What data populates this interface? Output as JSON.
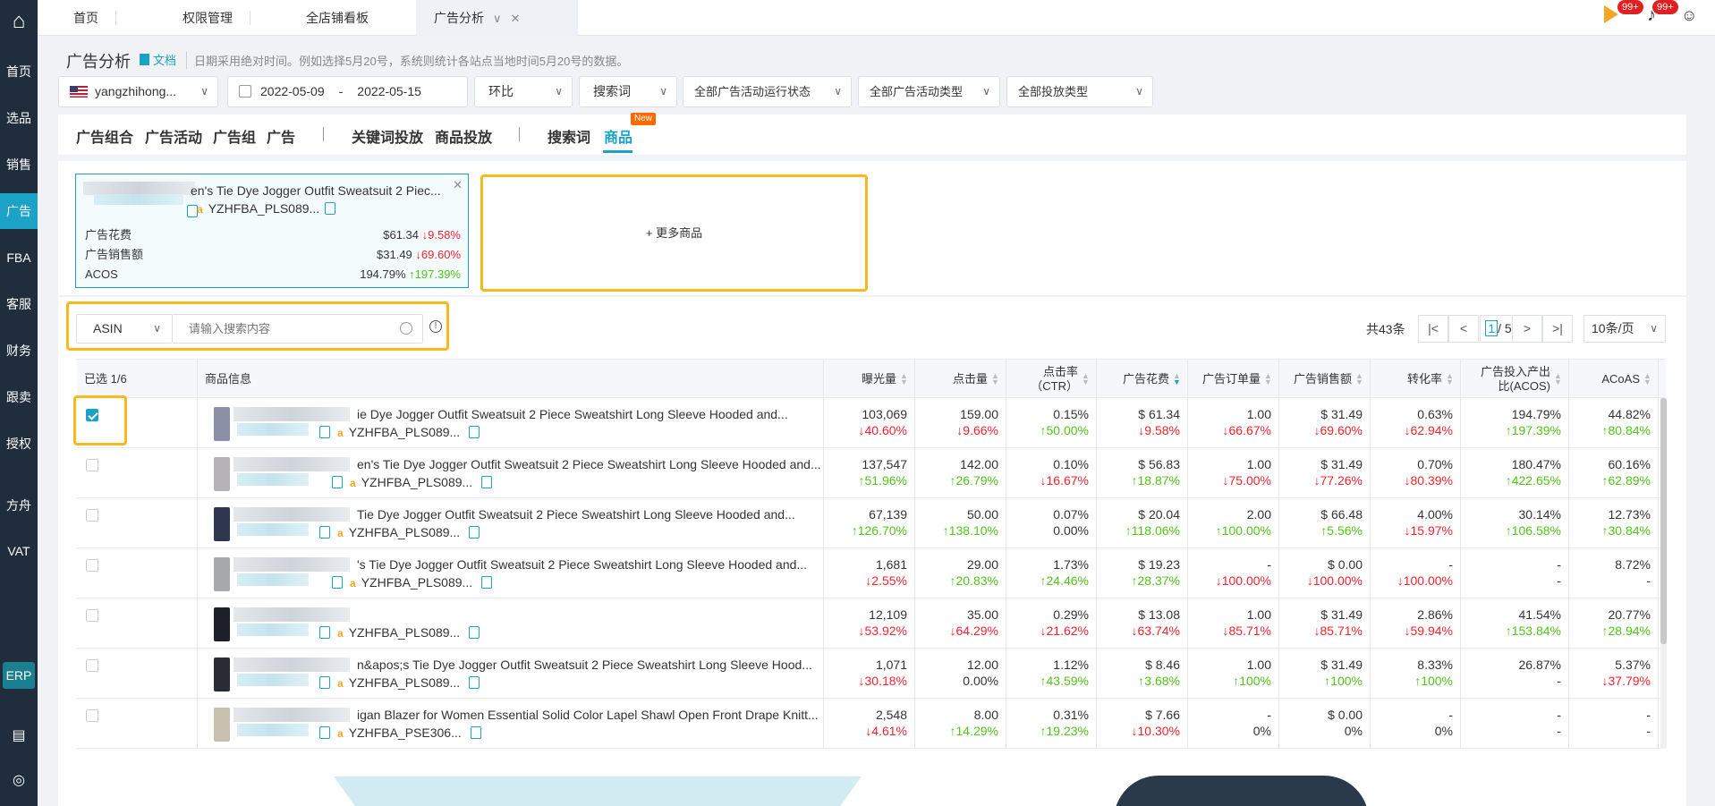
{
  "sidebar": {
    "items": [
      "首页",
      "选品",
      "销售",
      "广告",
      "FBA",
      "客服",
      "财务",
      "跟卖",
      "授权",
      "方舟",
      "VAT"
    ],
    "active_index": 3,
    "erp_label": "ERP"
  },
  "top_tabs": [
    "首页",
    "权限管理",
    "全店铺看板",
    "广告分析"
  ],
  "notifications": {
    "badge_a": "99+",
    "badge_b": "99+"
  },
  "header": {
    "title": "广告分析",
    "doc_label": "文档",
    "note": "日期采用绝对时间。例如选择5月20号，系统则统计各站点当地时间5月20号的数据。"
  },
  "filters": {
    "store": "yangzhihong...",
    "date_start": "2022-05-09",
    "date_sep": "-",
    "date_end": "2022-05-15",
    "compare": "环比",
    "dimension": "搜索词",
    "status": "全部广告活动运行状态",
    "campaign_type": "全部广告活动类型",
    "placement": "全部投放类型"
  },
  "type_tabs": [
    "广告组合",
    "广告活动",
    "广告组",
    "广告",
    "关键词投放",
    "商品投放",
    "搜索词",
    "商品"
  ],
  "new_badge": "New",
  "compare_card": {
    "title": "en's Tie Dye Jogger Outfit Sweatsuit 2 Piec...",
    "asin": "YZHFBA_PLS089...",
    "metrics": [
      {
        "label": "广告花费",
        "value": "$61.34",
        "change": "↓9.58%",
        "dir": "down"
      },
      {
        "label": "广告销售额",
        "value": "$31.49",
        "change": "↓69.60%",
        "dir": "down"
      },
      {
        "label": "ACOS",
        "value": "194.79%",
        "change": "↑197.39%",
        "dir": "up"
      }
    ],
    "add_more": "+ 更多商品"
  },
  "search": {
    "field": "ASIN",
    "placeholder": "请输入搜索内容"
  },
  "pagination": {
    "total": "共43条",
    "current": "1",
    "pages": "/ 5",
    "page_size": "10条/页"
  },
  "table": {
    "columns": [
      "已选 1/6",
      "商品信息",
      "曝光量",
      "点击量",
      "点击率（CTR）",
      "广告花费",
      "广告订单量",
      "广告销售额",
      "转化率",
      "广告投入产出比(ACOS)",
      "ACoAS"
    ],
    "rows": [
      {
        "checked": true,
        "title": "ie Dye Jogger Outfit Sweatsuit 2 Piece Sweatshirt Long Sleeve Hooded and...",
        "asin": "YZHFBA_PLS089...",
        "cells": [
          [
            "103,069",
            "↓40.60%",
            "down"
          ],
          [
            "159.00",
            "↓9.66%",
            "down"
          ],
          [
            "0.15%",
            "↑50.00%",
            "up"
          ],
          [
            "$ 61.34",
            "↓9.58%",
            "down"
          ],
          [
            "1.00",
            "↓66.67%",
            "down"
          ],
          [
            "$ 31.49",
            "↓69.60%",
            "down"
          ],
          [
            "0.63%",
            "↓62.94%",
            "down"
          ],
          [
            "194.79%",
            "↑197.39%",
            "up"
          ],
          [
            "44.82%",
            "↑80.84%",
            "up"
          ]
        ]
      },
      {
        "checked": false,
        "title": "en's Tie Dye Jogger Outfit Sweatsuit 2 Piece Sweatshirt Long Sleeve Hooded and...",
        "asin": "YZHFBA_PLS089...",
        "cells": [
          [
            "137,547",
            "↑51.96%",
            "up"
          ],
          [
            "142.00",
            "↑26.79%",
            "up"
          ],
          [
            "0.10%",
            "↓16.67%",
            "down"
          ],
          [
            "$ 56.83",
            "↑18.87%",
            "up"
          ],
          [
            "1.00",
            "↓75.00%",
            "down"
          ],
          [
            "$ 31.49",
            "↓77.26%",
            "down"
          ],
          [
            "0.70%",
            "↓80.39%",
            "down"
          ],
          [
            "180.47%",
            "↑422.65%",
            "up"
          ],
          [
            "60.16%",
            "↑62.89%",
            "up"
          ]
        ]
      },
      {
        "checked": false,
        "title": "Tie Dye Jogger Outfit Sweatsuit 2 Piece Sweatshirt Long Sleeve Hooded and...",
        "asin": "YZHFBA_PLS089...",
        "cells": [
          [
            "67,139",
            "↑126.70%",
            "up"
          ],
          [
            "50.00",
            "↑138.10%",
            "up"
          ],
          [
            "0.07%",
            "0.00%",
            "neutral"
          ],
          [
            "$ 20.04",
            "↑118.06%",
            "up"
          ],
          [
            "2.00",
            "↑100.00%",
            "up"
          ],
          [
            "$ 66.48",
            "↑5.56%",
            "up"
          ],
          [
            "4.00%",
            "↓15.97%",
            "down"
          ],
          [
            "30.14%",
            "↑106.58%",
            "up"
          ],
          [
            "12.73%",
            "↑30.84%",
            "up"
          ]
        ]
      },
      {
        "checked": false,
        "title": "'s Tie Dye Jogger Outfit Sweatsuit 2 Piece Sweatshirt Long Sleeve Hooded and...",
        "asin": "YZHFBA_PLS089...",
        "cells": [
          [
            "1,681",
            "↓2.55%",
            "down"
          ],
          [
            "29.00",
            "↑20.83%",
            "up"
          ],
          [
            "1.73%",
            "↑24.46%",
            "up"
          ],
          [
            "$ 19.23",
            "↑28.37%",
            "up"
          ],
          [
            "-",
            "↓100.00%",
            "down"
          ],
          [
            "$ 0.00",
            "↓100.00%",
            "down"
          ],
          [
            "-",
            "↓100.00%",
            "down"
          ],
          [
            "-",
            "-",
            "neutral"
          ],
          [
            "8.72%",
            "-",
            "neutral"
          ]
        ]
      },
      {
        "checked": false,
        "title": "",
        "asin": "YZHFBA_PLS089...",
        "cells": [
          [
            "12,109",
            "↓53.92%",
            "down"
          ],
          [
            "35.00",
            "↓64.29%",
            "down"
          ],
          [
            "0.29%",
            "↓21.62%",
            "down"
          ],
          [
            "$ 13.08",
            "↓63.74%",
            "down"
          ],
          [
            "1.00",
            "↓85.71%",
            "down"
          ],
          [
            "$ 31.49",
            "↓85.71%",
            "down"
          ],
          [
            "2.86%",
            "↓59.94%",
            "down"
          ],
          [
            "41.54%",
            "↑153.84%",
            "up"
          ],
          [
            "20.77%",
            "↑28.94%",
            "up"
          ]
        ]
      },
      {
        "checked": false,
        "title": "n&apos;s Tie Dye Jogger Outfit Sweatsuit 2 Piece Sweatshirt Long Sleeve Hood...",
        "asin": "YZHFBA_PLS089...",
        "cells": [
          [
            "1,071",
            "↓30.18%",
            "down"
          ],
          [
            "12.00",
            "0.00%",
            "neutral"
          ],
          [
            "1.12%",
            "↑43.59%",
            "up"
          ],
          [
            "$ 8.46",
            "↑3.68%",
            "up"
          ],
          [
            "1.00",
            "↑100%",
            "up"
          ],
          [
            "$ 31.49",
            "↑100%",
            "up"
          ],
          [
            "8.33%",
            "↑100%",
            "up"
          ],
          [
            "26.87%",
            "-",
            "neutral"
          ],
          [
            "5.37%",
            "↓37.79%",
            "down"
          ]
        ]
      },
      {
        "checked": false,
        "title": "igan Blazer for Women Essential Solid Color Lapel Shawl Open Front Drape Knitt...",
        "asin": "YZHFBA_PSE306...",
        "cells": [
          [
            "2,548",
            "↓4.61%",
            "down"
          ],
          [
            "8.00",
            "↑14.29%",
            "up"
          ],
          [
            "0.31%",
            "↑19.23%",
            "up"
          ],
          [
            "$ 7.66",
            "↓10.30%",
            "down"
          ],
          [
            "-",
            "0%",
            "neutral"
          ],
          [
            "$ 0.00",
            "0%",
            "neutral"
          ],
          [
            "-",
            "0%",
            "neutral"
          ],
          [
            "-",
            "-",
            "neutral"
          ],
          [
            "-",
            "-",
            "neutral"
          ]
        ]
      }
    ]
  },
  "colors": {
    "accent": "#1aa3c6",
    "highlight": "#f9b81d",
    "up": "#52c41a",
    "down": "#f5222d",
    "sidebar": "#1f2d3d"
  }
}
